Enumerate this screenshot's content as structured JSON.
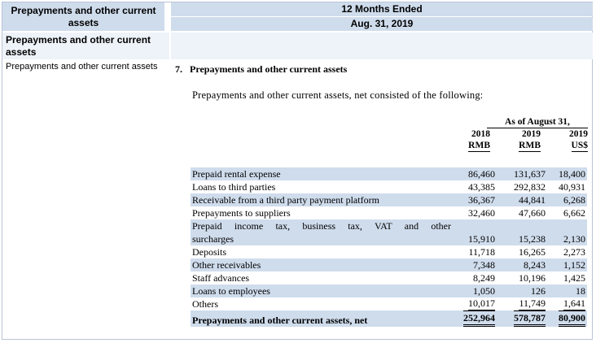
{
  "header": {
    "left_title": "Prepayments and other current assets",
    "period": "12 Months Ended",
    "date": "Aug. 31, 2019"
  },
  "section": {
    "title": "Prepayments and other current assets"
  },
  "row_label": "Prepayments and other current assets",
  "note": {
    "number": "7.",
    "title": "Prepayments and other current assets",
    "intro": "Prepayments and other current assets, net consisted of the following:",
    "as_of": "As of August 31,",
    "columns": [
      {
        "year": "2018",
        "unit": "RMB"
      },
      {
        "year": "2019",
        "unit": "RMB"
      },
      {
        "year": "2019",
        "unit": "US$"
      }
    ],
    "rows": [
      {
        "label": "Prepaid rental expense",
        "v": [
          "86,460",
          "131,637",
          "18,400"
        ]
      },
      {
        "label": "Loans to third parties",
        "v": [
          "43,385",
          "292,832",
          "40,931"
        ]
      },
      {
        "label": "Receivable from a third party payment platform",
        "v": [
          "36,367",
          "44,841",
          "6,268"
        ]
      },
      {
        "label": "Prepayments to suppliers",
        "v": [
          "32,460",
          "47,660",
          "6,662"
        ]
      },
      {
        "label": "Prepaid income tax, business tax, VAT and other",
        "v": [
          "",
          "",
          ""
        ]
      },
      {
        "label": "surcharges",
        "v": [
          "15,910",
          "15,238",
          "2,130"
        ]
      },
      {
        "label": "Deposits",
        "v": [
          "11,718",
          "16,265",
          "2,273"
        ]
      },
      {
        "label": "Other receivables",
        "v": [
          "7,348",
          "8,243",
          "1,152"
        ]
      },
      {
        "label": "Staff advances",
        "v": [
          "8,249",
          "10,196",
          "1,425"
        ]
      },
      {
        "label": "Loans to employees",
        "v": [
          "1,050",
          "126",
          "18"
        ]
      },
      {
        "label": "Others",
        "v": [
          "10,017",
          "11,749",
          "1,641"
        ]
      }
    ],
    "total": {
      "label": "Prepayments and other current assets, net",
      "v": [
        "252,964",
        "578,787",
        "80,900"
      ]
    }
  }
}
